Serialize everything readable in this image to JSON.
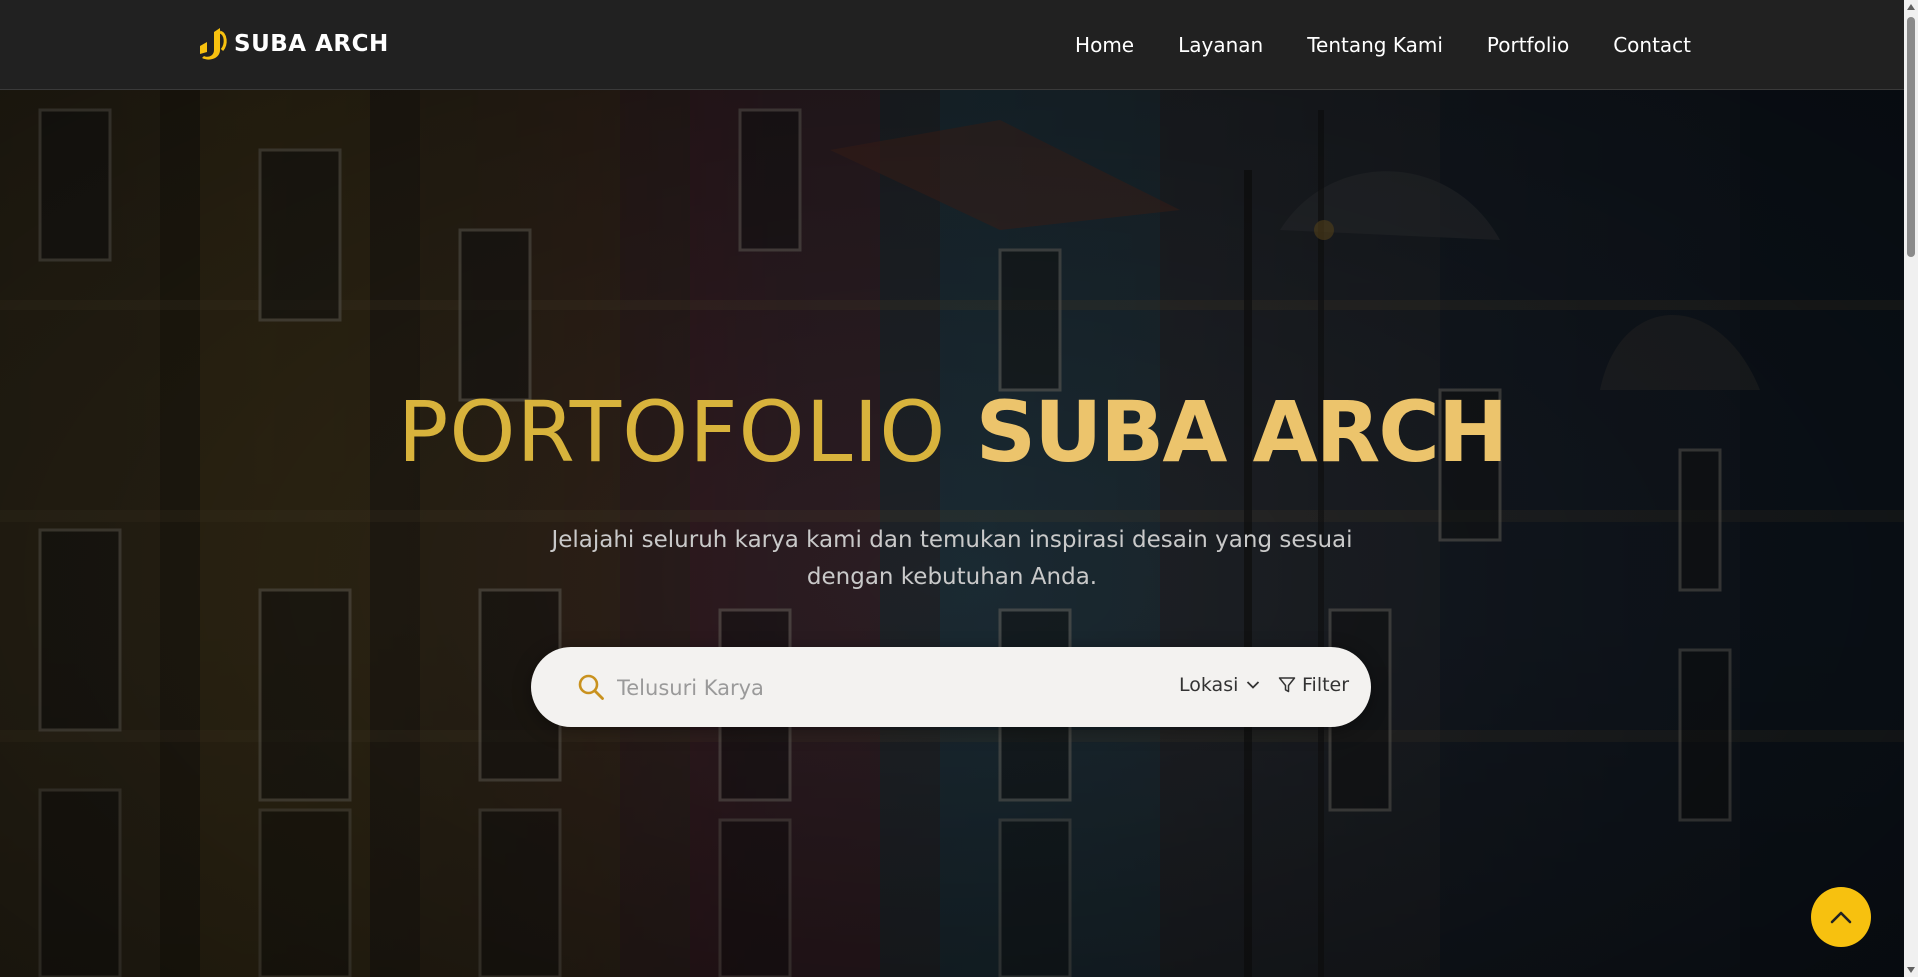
{
  "brand": {
    "name": "SUBA ARCH",
    "logo_icon": "suba-arch-logo-icon",
    "logo_color": "#f7c10f"
  },
  "nav": {
    "items": [
      {
        "label": "Home"
      },
      {
        "label": "Layanan"
      },
      {
        "label": "Tentang Kami"
      },
      {
        "label": "Portfolio"
      },
      {
        "label": "Contact"
      }
    ]
  },
  "hero": {
    "title_light": "PORTOFOLIO",
    "title_bold": "SUBA ARCH",
    "subtitle_line1": "Jelajahi seluruh karya kami dan temukan inspirasi desain yang sesuai",
    "subtitle_line2": "dengan kebutuhan Anda.",
    "title_light_color": "#d8b33c",
    "title_bold_color": "#ecc46c"
  },
  "search": {
    "placeholder": "Telusuri Karya",
    "value": "",
    "location_label": "Lokasi",
    "filter_label": "Filter",
    "icon_color": "#c9921e"
  },
  "back_to_top": {
    "icon": "chevron-up-icon",
    "color": "#f7c10f"
  }
}
